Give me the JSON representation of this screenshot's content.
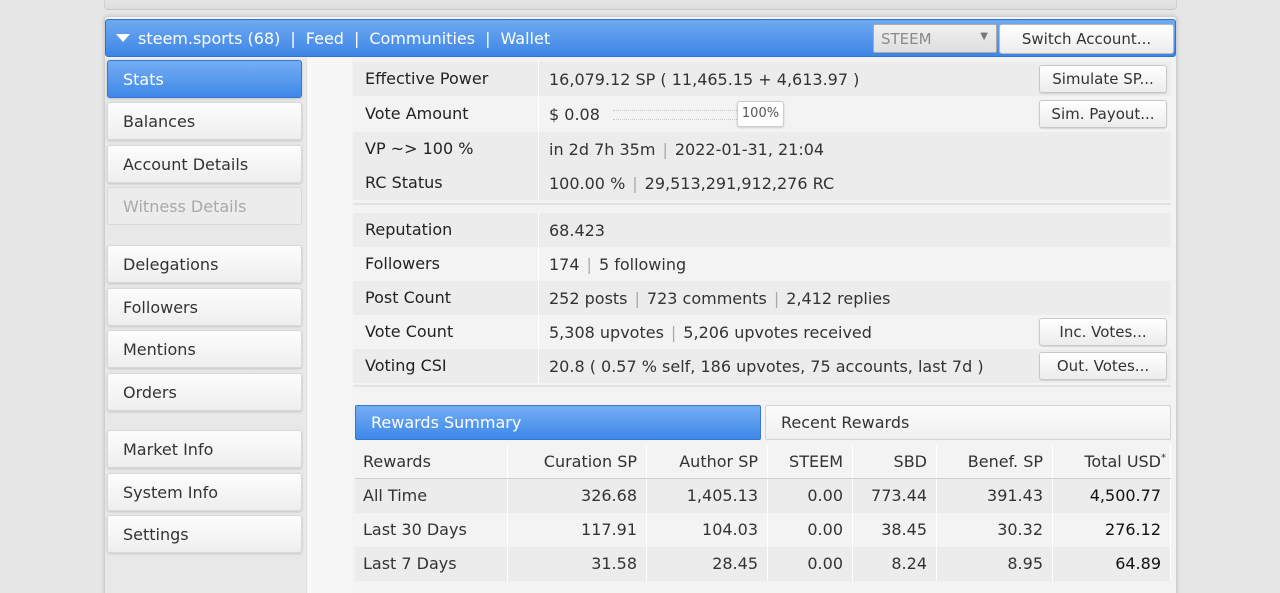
{
  "header": {
    "account_label": "steem.sports (68)",
    "nav": [
      "Feed",
      "Communities",
      "Wallet"
    ],
    "chain_select": "STEEM",
    "switch_account": "Switch Account..."
  },
  "sidebar": {
    "items": [
      {
        "label": "Stats",
        "state": "active"
      },
      {
        "label": "Balances",
        "state": "normal"
      },
      {
        "label": "Account Details",
        "state": "normal"
      },
      {
        "label": "Witness Details",
        "state": "disabled"
      },
      {
        "label": "Delegations",
        "state": "normal"
      },
      {
        "label": "Followers",
        "state": "normal"
      },
      {
        "label": "Mentions",
        "state": "normal"
      },
      {
        "label": "Orders",
        "state": "normal"
      },
      {
        "label": "Market Info",
        "state": "normal"
      },
      {
        "label": "System Info",
        "state": "normal"
      },
      {
        "label": "Settings",
        "state": "normal"
      }
    ]
  },
  "stats": {
    "effective_power": {
      "label": "Effective Power",
      "main": "16,079.12 SP",
      "detail": "( 11,465.15 + 4,613.97 )",
      "button": "Simulate SP..."
    },
    "vote_amount": {
      "label": "Vote Amount",
      "value": "$ 0.08",
      "percent": "100%",
      "button": "Sim. Payout..."
    },
    "vp": {
      "label": "VP ~> 100 %",
      "eta": "in 2d 7h 35m",
      "datetime": "2022-01-31, 21:04"
    },
    "rc": {
      "label": "RC Status",
      "percent": "100.00 %",
      "amount": "29,513,291,912,276 RC"
    },
    "reputation": {
      "label": "Reputation",
      "value": "68.423"
    },
    "followers": {
      "label": "Followers",
      "count": "174",
      "following": "5 following"
    },
    "post_count": {
      "label": "Post Count",
      "posts": "252 posts",
      "comments": "723 comments",
      "replies": "2,412 replies"
    },
    "vote_count": {
      "label": "Vote Count",
      "upvotes": "5,308 upvotes",
      "received": "5,206 upvotes received",
      "button": "Inc. Votes..."
    },
    "voting_csi": {
      "label": "Voting CSI",
      "value": "20.8 ( 0.57 % self, 186 upvotes, 75 accounts, last 7d )",
      "button": "Out. Votes..."
    }
  },
  "rewards": {
    "tabs": [
      "Rewards Summary",
      "Recent Rewards"
    ],
    "columns": [
      "Rewards",
      "Curation SP",
      "Author SP",
      "STEEM",
      "SBD",
      "Benef. SP",
      "Total USD"
    ],
    "total_mark": "*",
    "rows": [
      [
        "All Time",
        "326.68",
        "1,405.13",
        "0.00",
        "773.44",
        "391.43",
        "4,500.77"
      ],
      [
        "Last 30 Days",
        "117.91",
        "104.03",
        "0.00",
        "38.45",
        "30.32",
        "276.12"
      ],
      [
        "Last 7 Days",
        "31.58",
        "28.45",
        "0.00",
        "8.24",
        "8.95",
        "64.89"
      ]
    ]
  }
}
